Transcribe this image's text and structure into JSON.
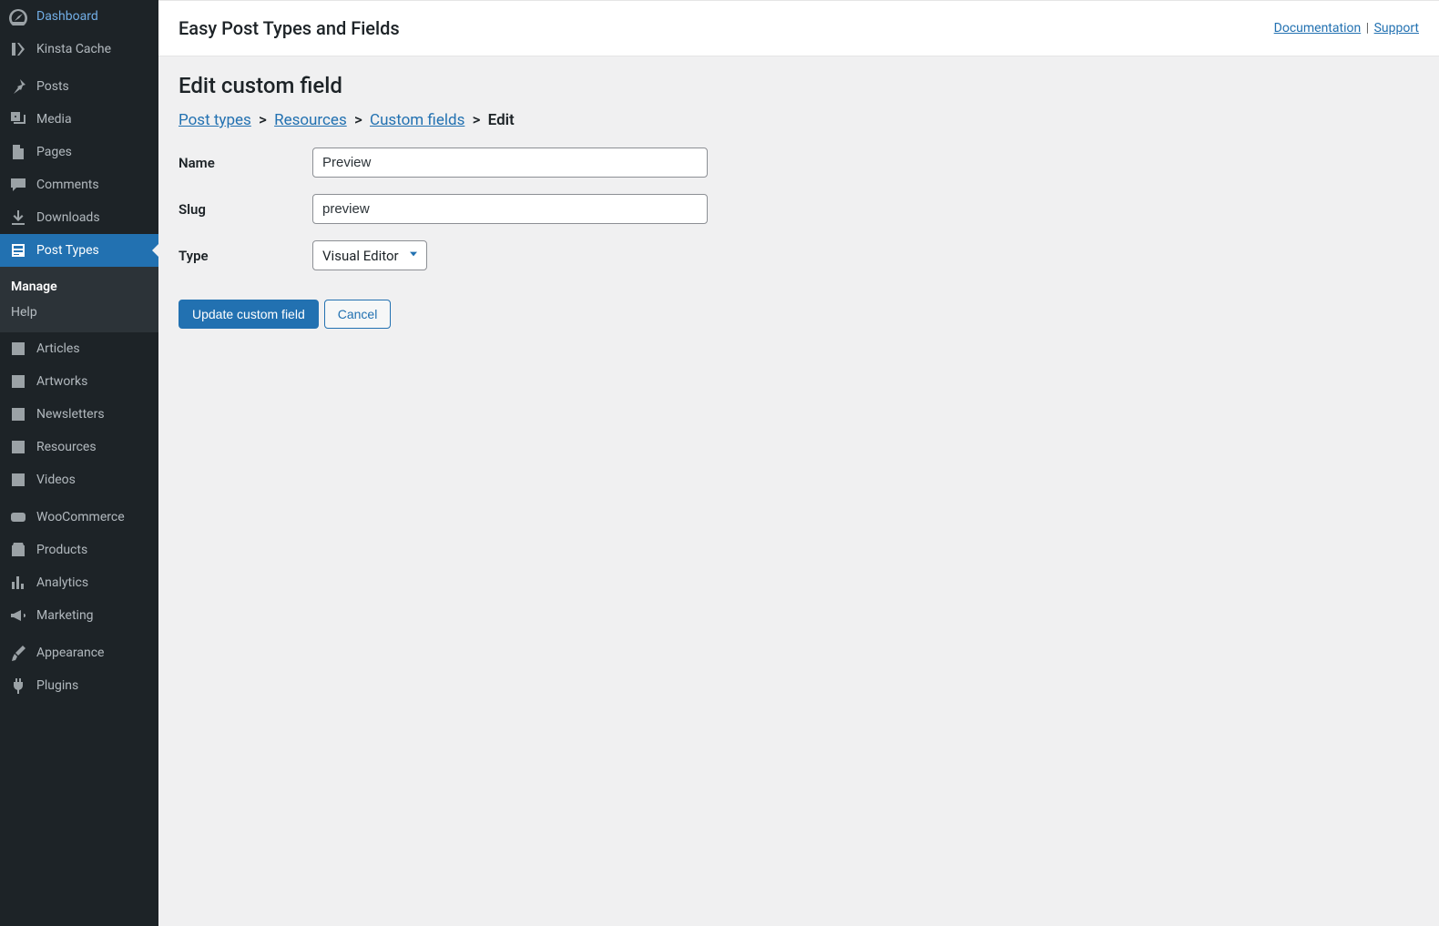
{
  "sidebar": {
    "items": [
      {
        "label": "Dashboard",
        "icon": "dashboard"
      },
      {
        "label": "Kinsta Cache",
        "icon": "kinsta"
      },
      {
        "label": "Posts",
        "icon": "pin"
      },
      {
        "label": "Media",
        "icon": "media"
      },
      {
        "label": "Pages",
        "icon": "page"
      },
      {
        "label": "Comments",
        "icon": "comment"
      },
      {
        "label": "Downloads",
        "icon": "download"
      },
      {
        "label": "Post Types",
        "icon": "post-types",
        "current": true
      },
      {
        "label": "Articles",
        "icon": "list"
      },
      {
        "label": "Artworks",
        "icon": "list"
      },
      {
        "label": "Newsletters",
        "icon": "list"
      },
      {
        "label": "Resources",
        "icon": "list"
      },
      {
        "label": "Videos",
        "icon": "list"
      },
      {
        "label": "WooCommerce",
        "icon": "woo"
      },
      {
        "label": "Products",
        "icon": "product"
      },
      {
        "label": "Analytics",
        "icon": "chart"
      },
      {
        "label": "Marketing",
        "icon": "megaphone"
      },
      {
        "label": "Appearance",
        "icon": "brush"
      },
      {
        "label": "Plugins",
        "icon": "plug"
      }
    ],
    "submenu": [
      {
        "label": "Manage",
        "current": true
      },
      {
        "label": "Help"
      }
    ]
  },
  "header": {
    "title": "Easy Post Types and Fields",
    "doc": "Documentation",
    "support": "Support"
  },
  "page": {
    "title": "Edit custom field"
  },
  "breadcrumb": {
    "post_types": "Post types",
    "resources": "Resources",
    "custom_fields": "Custom fields",
    "edit": "Edit"
  },
  "form": {
    "name_label": "Name",
    "name_value": "Preview",
    "slug_label": "Slug",
    "slug_value": "preview",
    "type_label": "Type",
    "type_value": "Visual Editor"
  },
  "actions": {
    "submit": "Update custom field",
    "cancel": "Cancel"
  }
}
